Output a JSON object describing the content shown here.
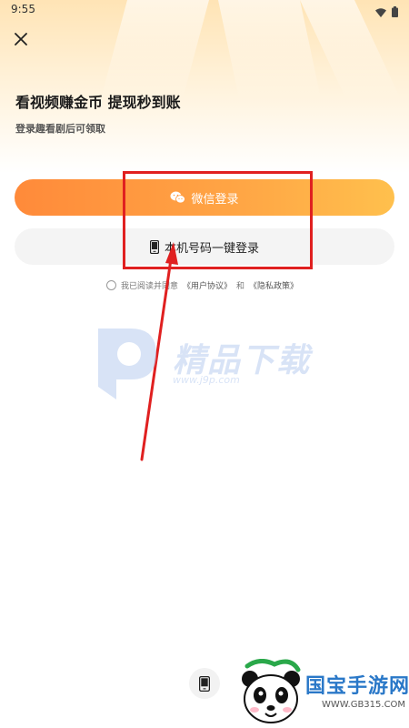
{
  "status_bar": {
    "time": "9:55",
    "icons": [
      "wifi-icon",
      "battery-icon"
    ]
  },
  "header": {
    "close_icon": "close-icon",
    "title": "看视频赚金币 提现秒到账",
    "subtitle": "登录趣看剧后可领取"
  },
  "login": {
    "wechat_label": "微信登录",
    "wechat_icon": "wechat-icon",
    "phone_label": "本机号码一键登录",
    "phone_icon": "phone-icon"
  },
  "agreement": {
    "prefix": "我已阅读并同意",
    "user_agreement": "《用户协议》",
    "and": "和",
    "privacy_policy": "《隐私政策》"
  },
  "watermark": {
    "text": "精品下载",
    "url": "www.j9p.com"
  },
  "footer": {
    "phone_icon": "phone-icon",
    "site_name": "国宝手游网",
    "site_url": "WWW.GB315.COM"
  },
  "colors": {
    "accent_start": "#ff8a3a",
    "accent_end": "#ffc04d",
    "highlight": "#e02020"
  }
}
